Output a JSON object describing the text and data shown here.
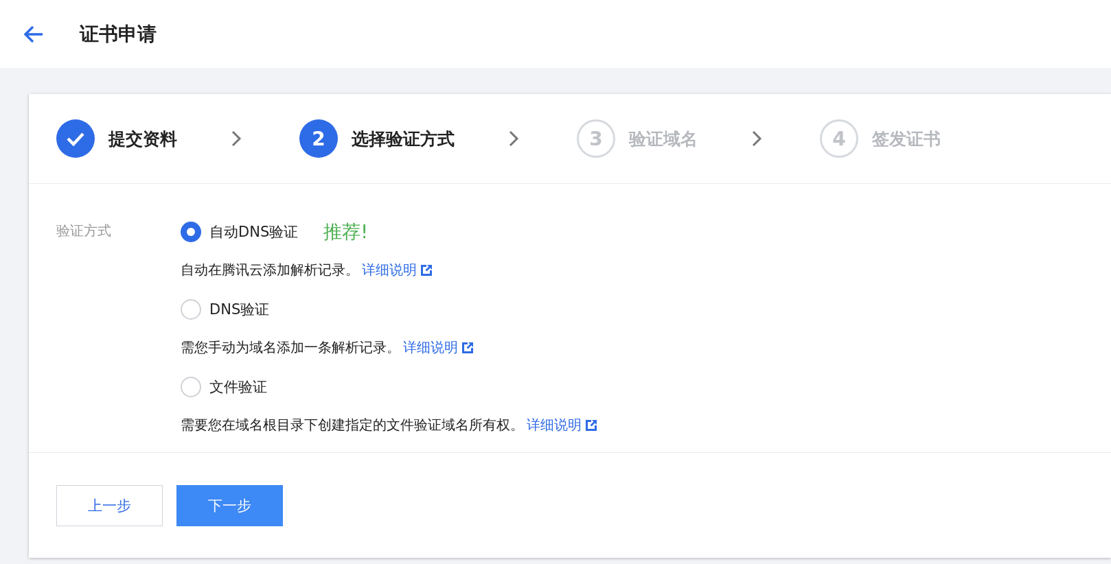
{
  "header": {
    "title": "证书申请"
  },
  "steps": [
    {
      "label": "提交资料",
      "kind": "done"
    },
    {
      "number": "2",
      "label": "选择验证方式",
      "kind": "active"
    },
    {
      "number": "3",
      "label": "验证域名",
      "kind": "pending"
    },
    {
      "number": "4",
      "label": "签发证书",
      "kind": "pending"
    }
  ],
  "form": {
    "label": "验证方式",
    "options": [
      {
        "label": "自动DNS验证",
        "selected": true,
        "badge": "推荐!",
        "description": "自动在腾讯云添加解析记录。",
        "link": "详细说明"
      },
      {
        "label": "DNS验证",
        "selected": false,
        "description": "需您手动为域名添加一条解析记录。",
        "link": "详细说明"
      },
      {
        "label": "文件验证",
        "selected": false,
        "description": "需要您在域名根目录下创建指定的文件验证域名所有权。",
        "link": "详细说明"
      }
    ]
  },
  "buttons": [
    {
      "label": "上一步",
      "kind": "secondary"
    },
    {
      "label": "下一步",
      "kind": "primary"
    }
  ]
}
